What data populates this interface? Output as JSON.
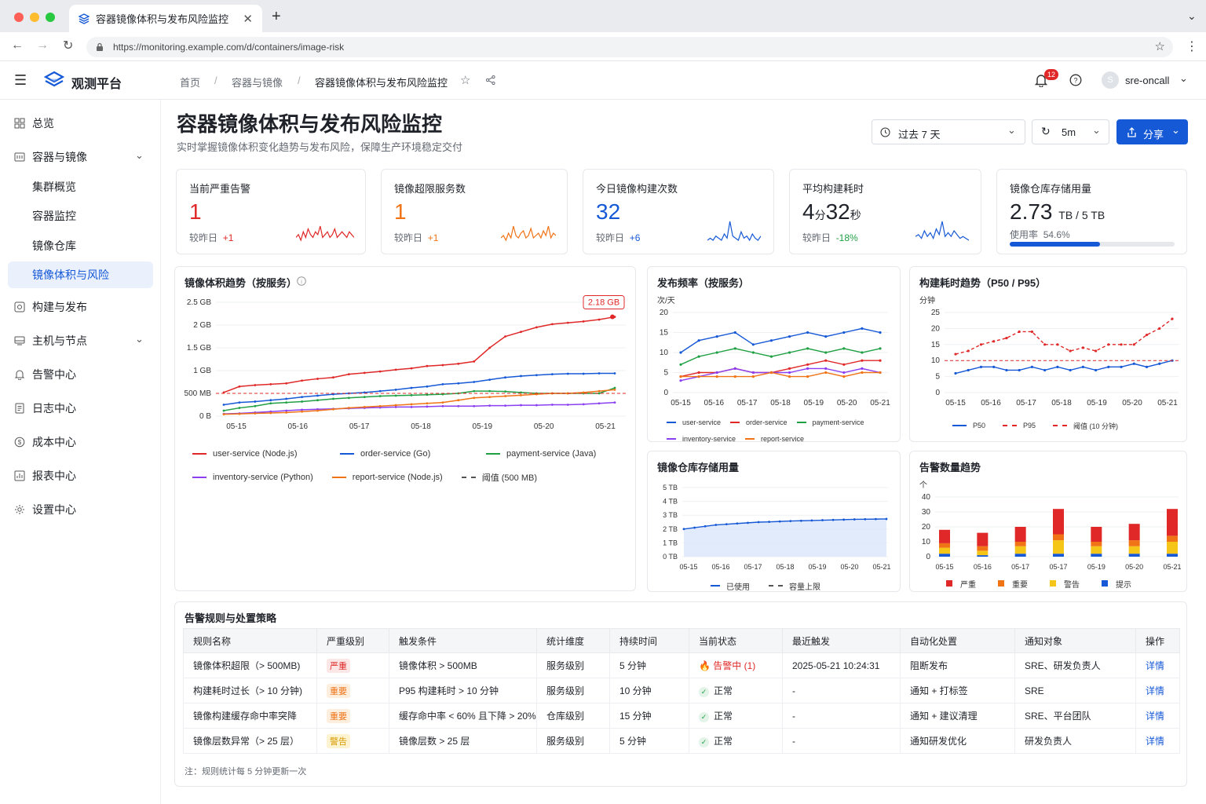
{
  "browser": {
    "tab_title": "容器镜像体积与发布风险监控",
    "url": "https://monitoring.example.com/d/containers/image-risk"
  },
  "app": {
    "name": "观测平台",
    "breadcrumb": [
      "首页",
      "容器与镜像",
      "容器镜像体积与发布风险监控"
    ],
    "notif_count": "12",
    "user": "sre-oncall",
    "avatar": "S"
  },
  "sidebar": {
    "items": [
      {
        "label": "总览",
        "icon": "grid-icon"
      },
      {
        "label": "容器与镜像",
        "icon": "container-icon"
      },
      {
        "label": "集群概览"
      },
      {
        "label": "容器监控"
      },
      {
        "label": "镜像仓库"
      },
      {
        "label": "镜像体积与风险"
      },
      {
        "label": "构建与发布",
        "icon": "build-icon"
      },
      {
        "label": "主机与节点",
        "icon": "server-icon"
      },
      {
        "label": "告警中心",
        "icon": "bell-icon"
      },
      {
        "label": "日志中心",
        "icon": "log-icon"
      },
      {
        "label": "成本中心",
        "icon": "cost-icon"
      },
      {
        "label": "报表中心",
        "icon": "report-icon"
      },
      {
        "label": "设置中心",
        "icon": "gear-icon"
      }
    ]
  },
  "page": {
    "title": "容器镜像体积与发布风险监控",
    "subtitle": "实时掌握镜像体积变化趋势与发布风险，保障生产环境稳定交付",
    "time_range": "过去 7 天",
    "refresh": "5m",
    "share": "分享"
  },
  "kpis": [
    {
      "title": "当前严重告警",
      "value": "1",
      "cmp": "较昨日",
      "delta": "+1",
      "color": "#e02828",
      "spark": "#e02828",
      "spark_values": [
        5,
        6,
        4,
        7,
        5,
        8,
        6,
        5,
        7,
        6,
        9,
        5,
        6,
        7,
        5,
        6,
        8,
        5,
        6,
        7,
        6,
        5,
        7,
        6,
        5
      ]
    },
    {
      "title": "镜像超限服务数",
      "value": "1",
      "cmp": "较昨日",
      "delta": "+1",
      "color": "#f07316",
      "spark": "#f07316",
      "spark_values": [
        4,
        5,
        3,
        6,
        4,
        9,
        5,
        4,
        6,
        7,
        4,
        5,
        8,
        4,
        5,
        6,
        4,
        7,
        5,
        9,
        4,
        6,
        5
      ]
    },
    {
      "title": "今日镜像构建次数",
      "value": "32",
      "cmp": "较昨日",
      "delta": "+6",
      "color": "#1659d6",
      "spark": "#1659d6",
      "spark_values": [
        4,
        5,
        4,
        6,
        5,
        4,
        7,
        5,
        13,
        6,
        5,
        4,
        8,
        5,
        6,
        4,
        7,
        5,
        4,
        6
      ]
    },
    {
      "title": "平均构建耗时",
      "value_main": "4",
      "unit1": "分",
      "value_2": "32",
      "unit2": "秒",
      "cmp": "较昨日",
      "delta": "-18%",
      "color": "#1f2329",
      "spark": "#1659d6",
      "spark_values": [
        5,
        6,
        4,
        8,
        5,
        7,
        4,
        9,
        6,
        13,
        5,
        7,
        5,
        8,
        6,
        4,
        5,
        4,
        3
      ]
    },
    {
      "title": "镜像仓库存储用量",
      "value_main": "2.73",
      "unit1": "TB / 5 TB",
      "cmp": "使用率",
      "delta": "54.6%",
      "progress": 0.546
    }
  ],
  "charts": {
    "size_trend": {
      "title": "镜像体积趋势（按服务）",
      "callout": "2.18 GB",
      "yticks": [
        "2.5 GB",
        "2 GB",
        "1.5 GB",
        "1 GB",
        "500 MB",
        "0 B"
      ],
      "legend": [
        "user-service (Node.js)",
        "order-service (Go)",
        "payment-service (Java)",
        "inventory-service (Python)",
        "report-service (Node.js)",
        "阈值 (500 MB)"
      ]
    },
    "freq": {
      "title": "发布频率（按服务）",
      "unit": "次/天",
      "legend": [
        "user-service",
        "order-service",
        "payment-service",
        "inventory-service",
        "report-service"
      ]
    },
    "build_time": {
      "title": "构建耗时趋势（P50 / P95）",
      "unit": "分钟",
      "legend": [
        "P50",
        "P95",
        "阈值 (10 分钟)"
      ]
    },
    "storage": {
      "title": "镜像仓库存储用量",
      "legend": [
        "已使用",
        "容量上限"
      ]
    },
    "alerts": {
      "title": "告警数量趋势",
      "unit": "个",
      "legend": [
        "严重",
        "重要",
        "警告",
        "提示"
      ]
    }
  },
  "chart_data": [
    {
      "type": "line",
      "title": "镜像体积趋势（按服务）",
      "ylabel": "",
      "ylim": [
        0,
        2.5
      ],
      "yunit": "GB",
      "x": [
        "05-15",
        "05-16",
        "05-17",
        "05-18",
        "05-19",
        "05-20",
        "05-21"
      ],
      "series": [
        {
          "name": "user-service (Node.js)",
          "color": "#e02828",
          "values": [
            0.52,
            0.65,
            0.68,
            0.7,
            0.72,
            0.78,
            0.82,
            0.85,
            0.92,
            0.95,
            0.98,
            1.02,
            1.05,
            1.1,
            1.12,
            1.15,
            1.2,
            1.5,
            1.75,
            1.85,
            1.95,
            2.02,
            2.05,
            2.08,
            2.12,
            2.18
          ]
        },
        {
          "name": "order-service (Go)",
          "color": "#1659d6",
          "values": [
            0.25,
            0.3,
            0.32,
            0.35,
            0.38,
            0.42,
            0.45,
            0.48,
            0.5,
            0.52,
            0.55,
            0.58,
            0.62,
            0.65,
            0.7,
            0.72,
            0.75,
            0.8,
            0.85,
            0.88,
            0.9,
            0.92,
            0.93,
            0.93,
            0.94,
            0.94
          ]
        },
        {
          "name": "payment-service (Java)",
          "color": "#20a045",
          "values": [
            0.12,
            0.18,
            0.22,
            0.28,
            0.3,
            0.32,
            0.35,
            0.38,
            0.4,
            0.42,
            0.44,
            0.45,
            0.46,
            0.47,
            0.48,
            0.5,
            0.55,
            0.55,
            0.54,
            0.52,
            0.5,
            0.5,
            0.5,
            0.5,
            0.5,
            0.62
          ]
        },
        {
          "name": "inventory-service (Python)",
          "color": "#8a3ff2",
          "values": [
            0.05,
            0.06,
            0.08,
            0.1,
            0.12,
            0.14,
            0.15,
            0.16,
            0.17,
            0.18,
            0.19,
            0.2,
            0.2,
            0.21,
            0.22,
            0.22,
            0.22,
            0.23,
            0.23,
            0.24,
            0.24,
            0.25,
            0.25,
            0.26,
            0.28,
            0.3
          ]
        },
        {
          "name": "report-service (Node.js)",
          "color": "#f07316",
          "values": [
            0.04,
            0.05,
            0.06,
            0.07,
            0.08,
            0.1,
            0.12,
            0.15,
            0.18,
            0.2,
            0.22,
            0.24,
            0.26,
            0.28,
            0.3,
            0.35,
            0.4,
            0.42,
            0.44,
            0.46,
            0.48,
            0.5,
            0.5,
            0.52,
            0.55,
            0.58
          ]
        }
      ],
      "threshold": 0.5
    },
    {
      "type": "line",
      "title": "发布频率（按服务）",
      "ylim": [
        0,
        20
      ],
      "x": [
        "05-15",
        "05-16",
        "05-17",
        "05-18",
        "05-19",
        "05-20",
        "05-21"
      ],
      "series": [
        {
          "name": "user-service",
          "color": "#1659d6",
          "values": [
            10,
            13,
            14,
            15,
            12,
            13,
            14,
            15,
            14,
            15,
            16,
            15
          ]
        },
        {
          "name": "order-service",
          "color": "#e02828",
          "values": [
            4,
            5,
            5,
            6,
            5,
            5,
            6,
            7,
            8,
            7,
            8,
            8
          ]
        },
        {
          "name": "payment-service",
          "color": "#20a045",
          "values": [
            7,
            9,
            10,
            11,
            10,
            9,
            10,
            11,
            10,
            11,
            10,
            11
          ]
        },
        {
          "name": "inventory-service",
          "color": "#8a3ff2",
          "values": [
            3,
            4,
            5,
            6,
            5,
            5,
            5,
            6,
            6,
            5,
            6,
            5
          ]
        },
        {
          "name": "report-service",
          "color": "#f07316",
          "values": [
            4,
            4,
            4,
            4,
            4,
            5,
            4,
            4,
            5,
            4,
            5,
            5
          ]
        }
      ]
    },
    {
      "type": "line",
      "title": "构建耗时趋势（P50 / P95）",
      "ylim": [
        0,
        25
      ],
      "x": [
        "05-15",
        "05-16",
        "05-17",
        "05-18",
        "05-19",
        "05-20",
        "05-21"
      ],
      "series": [
        {
          "name": "P50",
          "color": "#1659d6",
          "values": [
            6,
            7,
            8,
            8,
            7,
            7,
            8,
            7,
            8,
            7,
            8,
            7,
            8,
            8,
            9,
            8,
            9,
            10
          ]
        },
        {
          "name": "P95",
          "color": "#e02828",
          "values": [
            12,
            13,
            15,
            16,
            17,
            19,
            19,
            15,
            15,
            13,
            14,
            13,
            15,
            15,
            15,
            18,
            20,
            23
          ]
        }
      ],
      "threshold": 10
    },
    {
      "type": "area",
      "title": "镜像仓库存储用量",
      "ylim": [
        0,
        5
      ],
      "yunit": "TB",
      "x": [
        "05-15",
        "05-16",
        "05-17",
        "05-18",
        "05-19",
        "05-20",
        "05-21"
      ],
      "series": [
        {
          "name": "已使用",
          "color": "#1659d6",
          "values": [
            2.0,
            2.1,
            2.2,
            2.3,
            2.35,
            2.4,
            2.45,
            2.5,
            2.52,
            2.55,
            2.58,
            2.6,
            2.62,
            2.64,
            2.66,
            2.68,
            2.7,
            2.71,
            2.72,
            2.73
          ]
        }
      ],
      "capacity": 5
    },
    {
      "type": "bar",
      "title": "告警数量趋势",
      "ylim": [
        0,
        40
      ],
      "categories": [
        "05-15",
        "05-16",
        "05-17",
        "05-17",
        "05-19",
        "05-20",
        "05-21"
      ],
      "series": [
        {
          "name": "严重",
          "color": "#e02828",
          "values": [
            9,
            9,
            10,
            17,
            10,
            11,
            18
          ]
        },
        {
          "name": "重要",
          "color": "#f07316",
          "values": [
            3,
            3,
            3,
            4,
            3,
            4,
            4
          ]
        },
        {
          "name": "警告",
          "color": "#f5c518",
          "values": [
            4,
            3,
            5,
            9,
            5,
            5,
            8
          ]
        },
        {
          "name": "提示",
          "color": "#1659d6",
          "values": [
            2,
            1,
            2,
            2,
            2,
            2,
            2
          ]
        }
      ]
    }
  ],
  "rules": {
    "title": "告警规则与处置策略",
    "headers": [
      "规则名称",
      "严重级别",
      "触发条件",
      "统计维度",
      "持续时间",
      "当前状态",
      "最近触发",
      "自动化处置",
      "通知对象",
      "操作"
    ],
    "rows": [
      {
        "name": "镜像体积超限（> 500MB)",
        "level": "严重",
        "lvcolor": "#e02828",
        "lvbg": "#fde6e6",
        "cond": "镜像体积 > 500MB",
        "dim": "服务级别",
        "dur": "5 分钟",
        "status": "告警中 (1)",
        "alerting": true,
        "last": "2025-05-21 10:24:31",
        "action": "阻断发布",
        "notify": "SRE、研发负责人",
        "op": "详情"
      },
      {
        "name": "构建耗时过长（> 10 分钟)",
        "level": "重要",
        "lvcolor": "#f07316",
        "lvbg": "#fdeedd",
        "cond": "P95 构建耗时 > 10 分钟",
        "dim": "服务级别",
        "dur": "10 分钟",
        "status": "正常",
        "alerting": false,
        "last": "-",
        "action": "通知 + 打标签",
        "notify": "SRE",
        "op": "详情"
      },
      {
        "name": "镜像构建缓存命中率突降",
        "level": "重要",
        "lvcolor": "#f07316",
        "lvbg": "#fdeedd",
        "cond": "缓存命中率 < 60% 且下降 > 20%",
        "dim": "仓库级别",
        "dur": "15 分钟",
        "status": "正常",
        "alerting": false,
        "last": "-",
        "action": "通知 + 建议清理",
        "notify": "SRE、平台团队",
        "op": "详情"
      },
      {
        "name": "镜像层数异常（> 25 层）",
        "level": "警告",
        "lvcolor": "#d89a00",
        "lvbg": "#fdf3d0",
        "cond": "镜像层数 > 25 层",
        "dim": "服务级别",
        "dur": "5 分钟",
        "status": "正常",
        "alerting": false,
        "last": "-",
        "action": "通知研发优化",
        "notify": "研发负责人",
        "op": "详情"
      }
    ],
    "note": "注：规则统计每 5 分钟更新一次"
  }
}
